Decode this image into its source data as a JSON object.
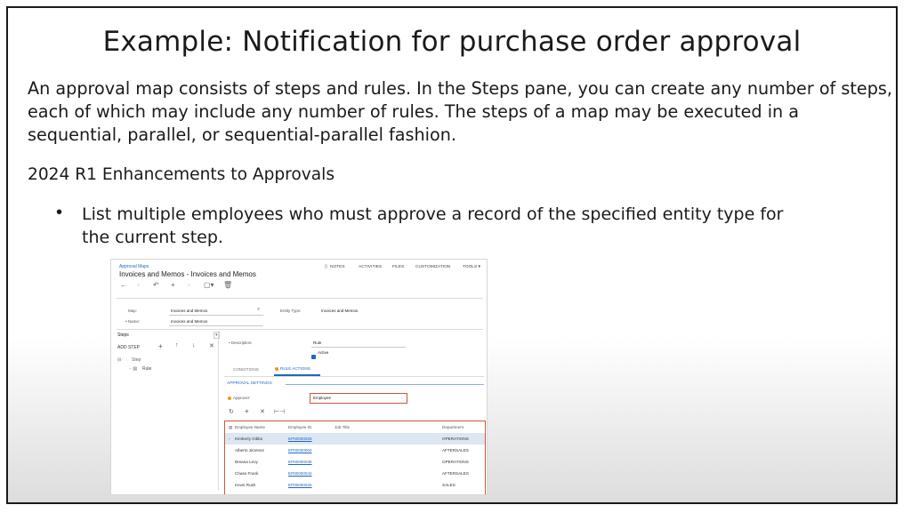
{
  "slide": {
    "title": "Example:  Notification for purchase order approval",
    "paragraph": "An approval map consists of steps and rules. In the Steps pane, you can create any number of steps, each of which may include any number of rules.  The steps of a map may be executed in a sequential, parallel, or sequential-parallel fashion.",
    "subheading": "2024 R1 Enhancements to Approvals",
    "bullet": "List multiple employees who must approve a record of the specified entity type for the current step."
  },
  "screenshot": {
    "breadcrumb": "Approval Maps",
    "title": "Invoices and Memos - Invoices and Memos",
    "top_menu": [
      "NOTES",
      "ACTIVITIES",
      "FILES",
      "CUSTOMIZATION",
      "TOOLS ▾"
    ],
    "form": {
      "map_label": "Map:",
      "map_value": "Invoices and Memos",
      "name_label": "• Name:",
      "name_value": "Invoices and Memos",
      "entity_label": "Entity Type:",
      "entity_value": "Invoices and Memos"
    },
    "steps_pane": {
      "header": "Steps",
      "add_step": "ADD STEP",
      "tree_step": "Step",
      "tree_rule": "Rule"
    },
    "detail": {
      "description_label": "• Description:",
      "description_value": "Rule",
      "active_label": "Active",
      "tabs": [
        "CONDITIONS",
        "RULE ACTIONS"
      ],
      "section": "APPROVAL SETTINGS",
      "approver_label": "Approver:",
      "approver_value": "Employee"
    },
    "grid": {
      "columns": [
        "Employee Name",
        "Employee ID",
        "Job Title",
        "Department"
      ],
      "rows": [
        {
          "name": "Kimberly Gibbs",
          "id": "EP00000026",
          "title": "",
          "dept": "OPERATIONS"
        },
        {
          "name": "Alberto Jimenez",
          "id": "EP00000004",
          "title": "",
          "dept": "AFTERSALES"
        },
        {
          "name": "Breana Levy",
          "id": "EP00000036",
          "title": "",
          "dept": "OPERATIONS"
        },
        {
          "name": "Chase Frank",
          "id": "EP00000042",
          "title": "",
          "dept": "AFTERSALES"
        },
        {
          "name": "Kevin Rush",
          "id": "EP00000025",
          "title": "",
          "dept": "SALES"
        }
      ]
    }
  }
}
